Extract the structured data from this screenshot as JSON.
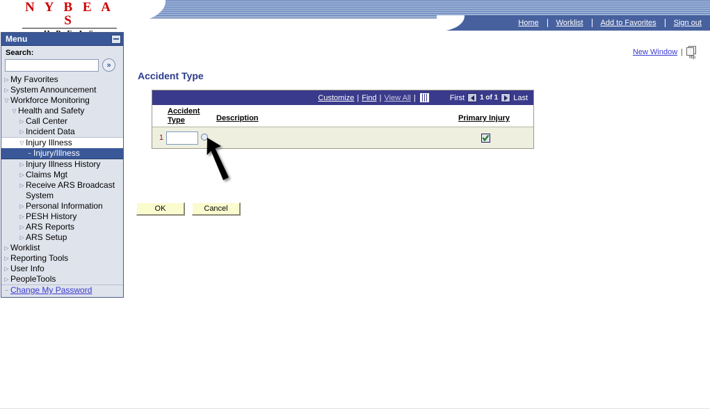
{
  "header": {
    "logo_main": "N Y B E A S",
    "logo_sub": "H B E A S",
    "nav_links": [
      {
        "label": "Home",
        "name": "nav-home"
      },
      {
        "label": "Worklist",
        "name": "nav-worklist"
      },
      {
        "label": "Add to Favorites",
        "name": "nav-add-to-favorites"
      },
      {
        "label": "Sign out",
        "name": "nav-sign-out"
      }
    ]
  },
  "menu": {
    "title": "Menu",
    "collapse_icon": "minimize-icon",
    "search_label": "Search:",
    "search_value": "",
    "search_placeholder": "",
    "search_go_glyph": "»",
    "items": [
      {
        "label": "My Favorites",
        "level": 1,
        "state": "collapsed"
      },
      {
        "label": "System Announcement",
        "level": 1,
        "state": "collapsed"
      },
      {
        "label": "Workforce Monitoring",
        "level": 1,
        "state": "expanded"
      },
      {
        "label": "Health and Safety",
        "level": 2,
        "state": "expanded"
      },
      {
        "label": "Call Center",
        "level": 3,
        "state": "collapsed"
      },
      {
        "label": "Incident Data",
        "level": 3,
        "state": "collapsed"
      },
      {
        "label": "Injury Illness",
        "level": 3,
        "state": "expanded"
      },
      {
        "label": "Injury/Illness",
        "level": 4,
        "state": "selected"
      },
      {
        "label": "Injury Illness History",
        "level": 3,
        "state": "collapsed"
      },
      {
        "label": "Claims Mgt",
        "level": 3,
        "state": "collapsed"
      },
      {
        "label": "Receive ARS Broadcast",
        "label2": "System",
        "level": 3,
        "state": "collapsed"
      },
      {
        "label": "Personal Information",
        "level": 3,
        "state": "collapsed"
      },
      {
        "label": "PESH History",
        "level": 3,
        "state": "collapsed"
      },
      {
        "label": "ARS Reports",
        "level": 3,
        "state": "collapsed"
      },
      {
        "label": "ARS Setup",
        "level": 3,
        "state": "collapsed"
      },
      {
        "label": "Worklist",
        "level": 1,
        "state": "collapsed"
      },
      {
        "label": "Reporting Tools",
        "level": 1,
        "state": "collapsed"
      },
      {
        "label": "User Info",
        "level": 1,
        "state": "collapsed"
      },
      {
        "label": "PeopleTools",
        "level": 1,
        "state": "collapsed"
      }
    ],
    "change_password_label": "Change My Password"
  },
  "main": {
    "new_window_label": "New Window",
    "new_window_separator": "|",
    "http_icon_label": "http",
    "page_title": "Accident Type",
    "grid": {
      "toolbar": {
        "customize": "Customize",
        "find": "Find",
        "view_all": "View All",
        "sep": "|",
        "grid_icon": "grid-icon",
        "first": "First",
        "counter": "1 of 1",
        "last": "Last"
      },
      "columns": {
        "accident_type_line1": "Accident",
        "accident_type_line2": "Type",
        "description": "Description",
        "primary_injury": "Primary Injury"
      },
      "rows": [
        {
          "num": "1",
          "accident_type": "",
          "description": "",
          "primary_injury_checked": true,
          "lookup_icon": "magnifier-icon"
        }
      ]
    },
    "buttons": {
      "ok": "OK",
      "cancel": "Cancel"
    }
  },
  "colors": {
    "brand_red": "#cc0000",
    "nav_blue": "#47619f",
    "menu_header_blue": "#3a5898",
    "grid_header_blue": "#3a3a8c",
    "row_beige": "#efefe0",
    "button_yellow": "#fbfbd0",
    "link_blue": "#3a3ad0",
    "check_green": "#1c7a1c"
  }
}
